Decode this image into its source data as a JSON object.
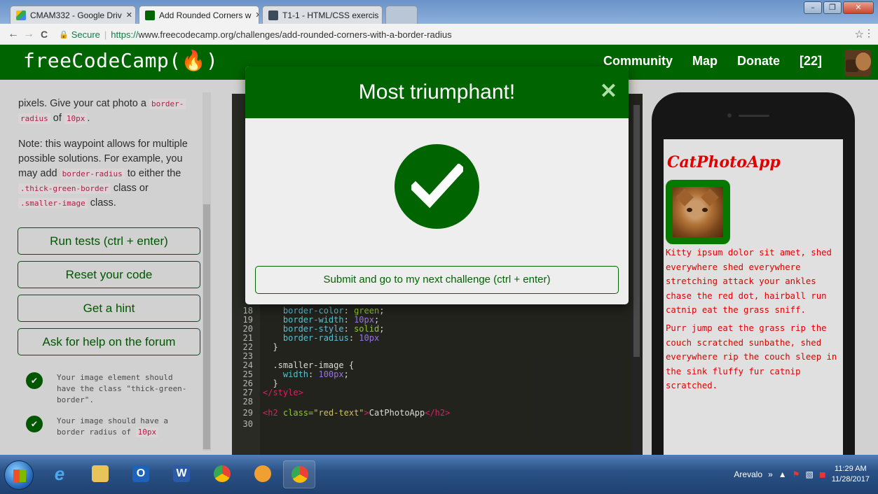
{
  "browser": {
    "tabs": [
      {
        "label": "CMAM332 - Google Driv",
        "active": false
      },
      {
        "label": "Add Rounded Corners w",
        "active": true
      },
      {
        "label": "T1-1 - HTML/CSS exercis",
        "active": false
      }
    ],
    "tab_close": "✕",
    "window_buttons": {
      "minimize": "–",
      "maximize": "❐",
      "close": "✕"
    },
    "nav": {
      "back": "←",
      "forward": "→",
      "reload": "C"
    },
    "secure_label": "Secure",
    "url_scheme": "https://",
    "url_rest": "www.freecodecamp.org/challenges/add-rounded-corners-with-a-border-radius",
    "bookmark_glyph": "☆",
    "menu_glyph": "⋮"
  },
  "fcc_nav": {
    "logo": "freeCodeCamp(🔥)",
    "links": [
      "Community",
      "Map",
      "Donate"
    ],
    "points": "[22]"
  },
  "instructions": {
    "line1_pre": "pixels. Give your cat photo a ",
    "line1_code1": "border-",
    "line1_code2": "radius",
    "line1_mid": " of ",
    "line1_code3": "10px",
    "line1_end": ".",
    "note_pre": "Note: this waypoint allows for multiple possible solutions. For example, you may add ",
    "note_code1": "border-radius",
    "note_mid1": " to either the ",
    "note_code2": ".thick-green-border",
    "note_mid2": " class or ",
    "note_code3": ".smaller-image",
    "note_end": " class."
  },
  "buttons": {
    "run": "Run tests (ctrl + enter)",
    "reset": "Reset your code",
    "hint": "Get a hint",
    "forum": "Ask for help on the forum"
  },
  "tests": [
    {
      "text_pre": "Your image element should have the class \"thick-green-border\".",
      "code": ""
    },
    {
      "text_pre": "Your image should have a border radius of ",
      "code": "10px"
    }
  ],
  "check_glyph": "✔",
  "code": {
    "l18": {
      "num": "18",
      "prop": "border-color",
      "val": "green"
    },
    "l19": {
      "num": "19",
      "prop": "border-width",
      "val": "10px"
    },
    "l20": {
      "num": "20",
      "prop": "border-style",
      "val": "solid"
    },
    "l21": {
      "num": "21",
      "prop": "border-radius",
      "val": "10px"
    },
    "l22": {
      "num": "22",
      "text": "}"
    },
    "l23": {
      "num": "23"
    },
    "l24": {
      "num": "24",
      "selector": ".smaller-image",
      "brace": " {"
    },
    "l25": {
      "num": "25",
      "prop": "width",
      "val": "100px"
    },
    "l26": {
      "num": "26",
      "text": "}"
    },
    "l27": {
      "num": "27",
      "tag": "</style>"
    },
    "l28": {
      "num": "28"
    },
    "l29": {
      "num": "29",
      "open": "<h2 ",
      "attr": "class=",
      "attrval": "\"red-text\"",
      "gt": ">",
      "content": "CatPhotoApp",
      "close": "</h2>"
    },
    "l30": {
      "num": "30"
    }
  },
  "preview": {
    "title": "CatPhotoApp",
    "para1": "Kitty ipsum dolor sit amet, shed everywhere shed everywhere stretching attack your ankles chase the red dot, hairball run catnip eat the grass sniff.",
    "para2": "Purr jump eat the grass rip the couch scratched sunbathe, shed everywhere rip the couch sleep in the sink fluffy fur catnip scratched."
  },
  "modal": {
    "title": "Most triumphant!",
    "close": "✕",
    "submit": "Submit and go to my next challenge (ctrl + enter)"
  },
  "taskbar": {
    "user": "Arevalo",
    "overflow": "»",
    "time": "11:29 AM",
    "date": "11/28/2017"
  },
  "colors": {
    "fcc_green": "#006400",
    "code_red": "#c7254e",
    "preview_red": "#ff0000"
  }
}
